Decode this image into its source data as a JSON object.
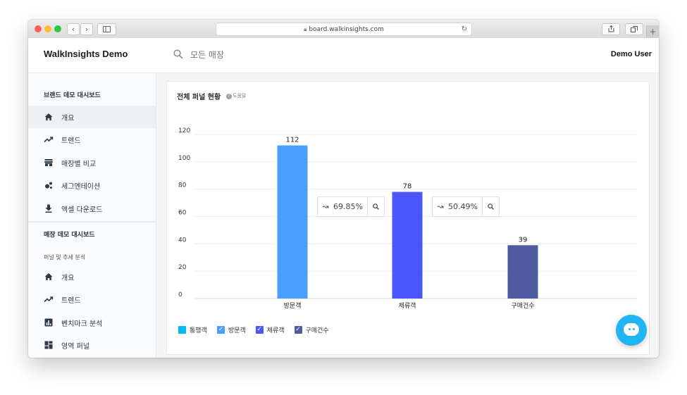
{
  "browser": {
    "url": "board.walkinsights.com",
    "nav_back": "‹",
    "nav_forward": "›",
    "plus": "+"
  },
  "header": {
    "brand": "WalkInsights Demo",
    "search_placeholder": "모든 매장",
    "user": "Demo User"
  },
  "sidebar": {
    "brand_section": "브랜드 데모 대시보드",
    "brand_items": [
      {
        "label": "개요",
        "icon": "home-icon"
      },
      {
        "label": "트렌드",
        "icon": "trending-up-icon"
      },
      {
        "label": "매장별 비교",
        "icon": "store-icon"
      },
      {
        "label": "세그멘테이션",
        "icon": "segment-icon"
      },
      {
        "label": "엑셀 다운로드",
        "icon": "download-icon"
      }
    ],
    "store_section": "매장 데모 대시보드",
    "store_subsection": "퍼널 및 추세 분석",
    "store_items": [
      {
        "label": "개요",
        "icon": "home-icon"
      },
      {
        "label": "트렌드",
        "icon": "trending-up-icon"
      },
      {
        "label": "벤치마크 분석",
        "icon": "bar-chart-icon"
      },
      {
        "label": "영역 퍼널",
        "icon": "dashboard-icon"
      }
    ]
  },
  "card": {
    "title": "전체 퍼널 현황",
    "help": "도움말"
  },
  "conversions": [
    {
      "value": "69.85%"
    },
    {
      "value": "50.49%"
    }
  ],
  "legend": [
    {
      "label": "통행객",
      "color": "#03b9f4",
      "checked": false
    },
    {
      "label": "방문객",
      "color": "#489ffd",
      "checked": true
    },
    {
      "label": "체류객",
      "color": "#4b56fb",
      "checked": true
    },
    {
      "label": "구매건수",
      "color": "#4e5ba0",
      "checked": true
    }
  ],
  "chart_data": {
    "type": "bar",
    "categories": [
      "방문객",
      "체류객",
      "구매건수"
    ],
    "values": [
      112,
      78,
      39
    ],
    "colors": [
      "#489ffd",
      "#4b56fb",
      "#4e5ba0"
    ],
    "yticks": [
      0,
      20,
      40,
      60,
      80,
      100,
      120
    ],
    "ylim": [
      0,
      120
    ],
    "grid": true
  }
}
